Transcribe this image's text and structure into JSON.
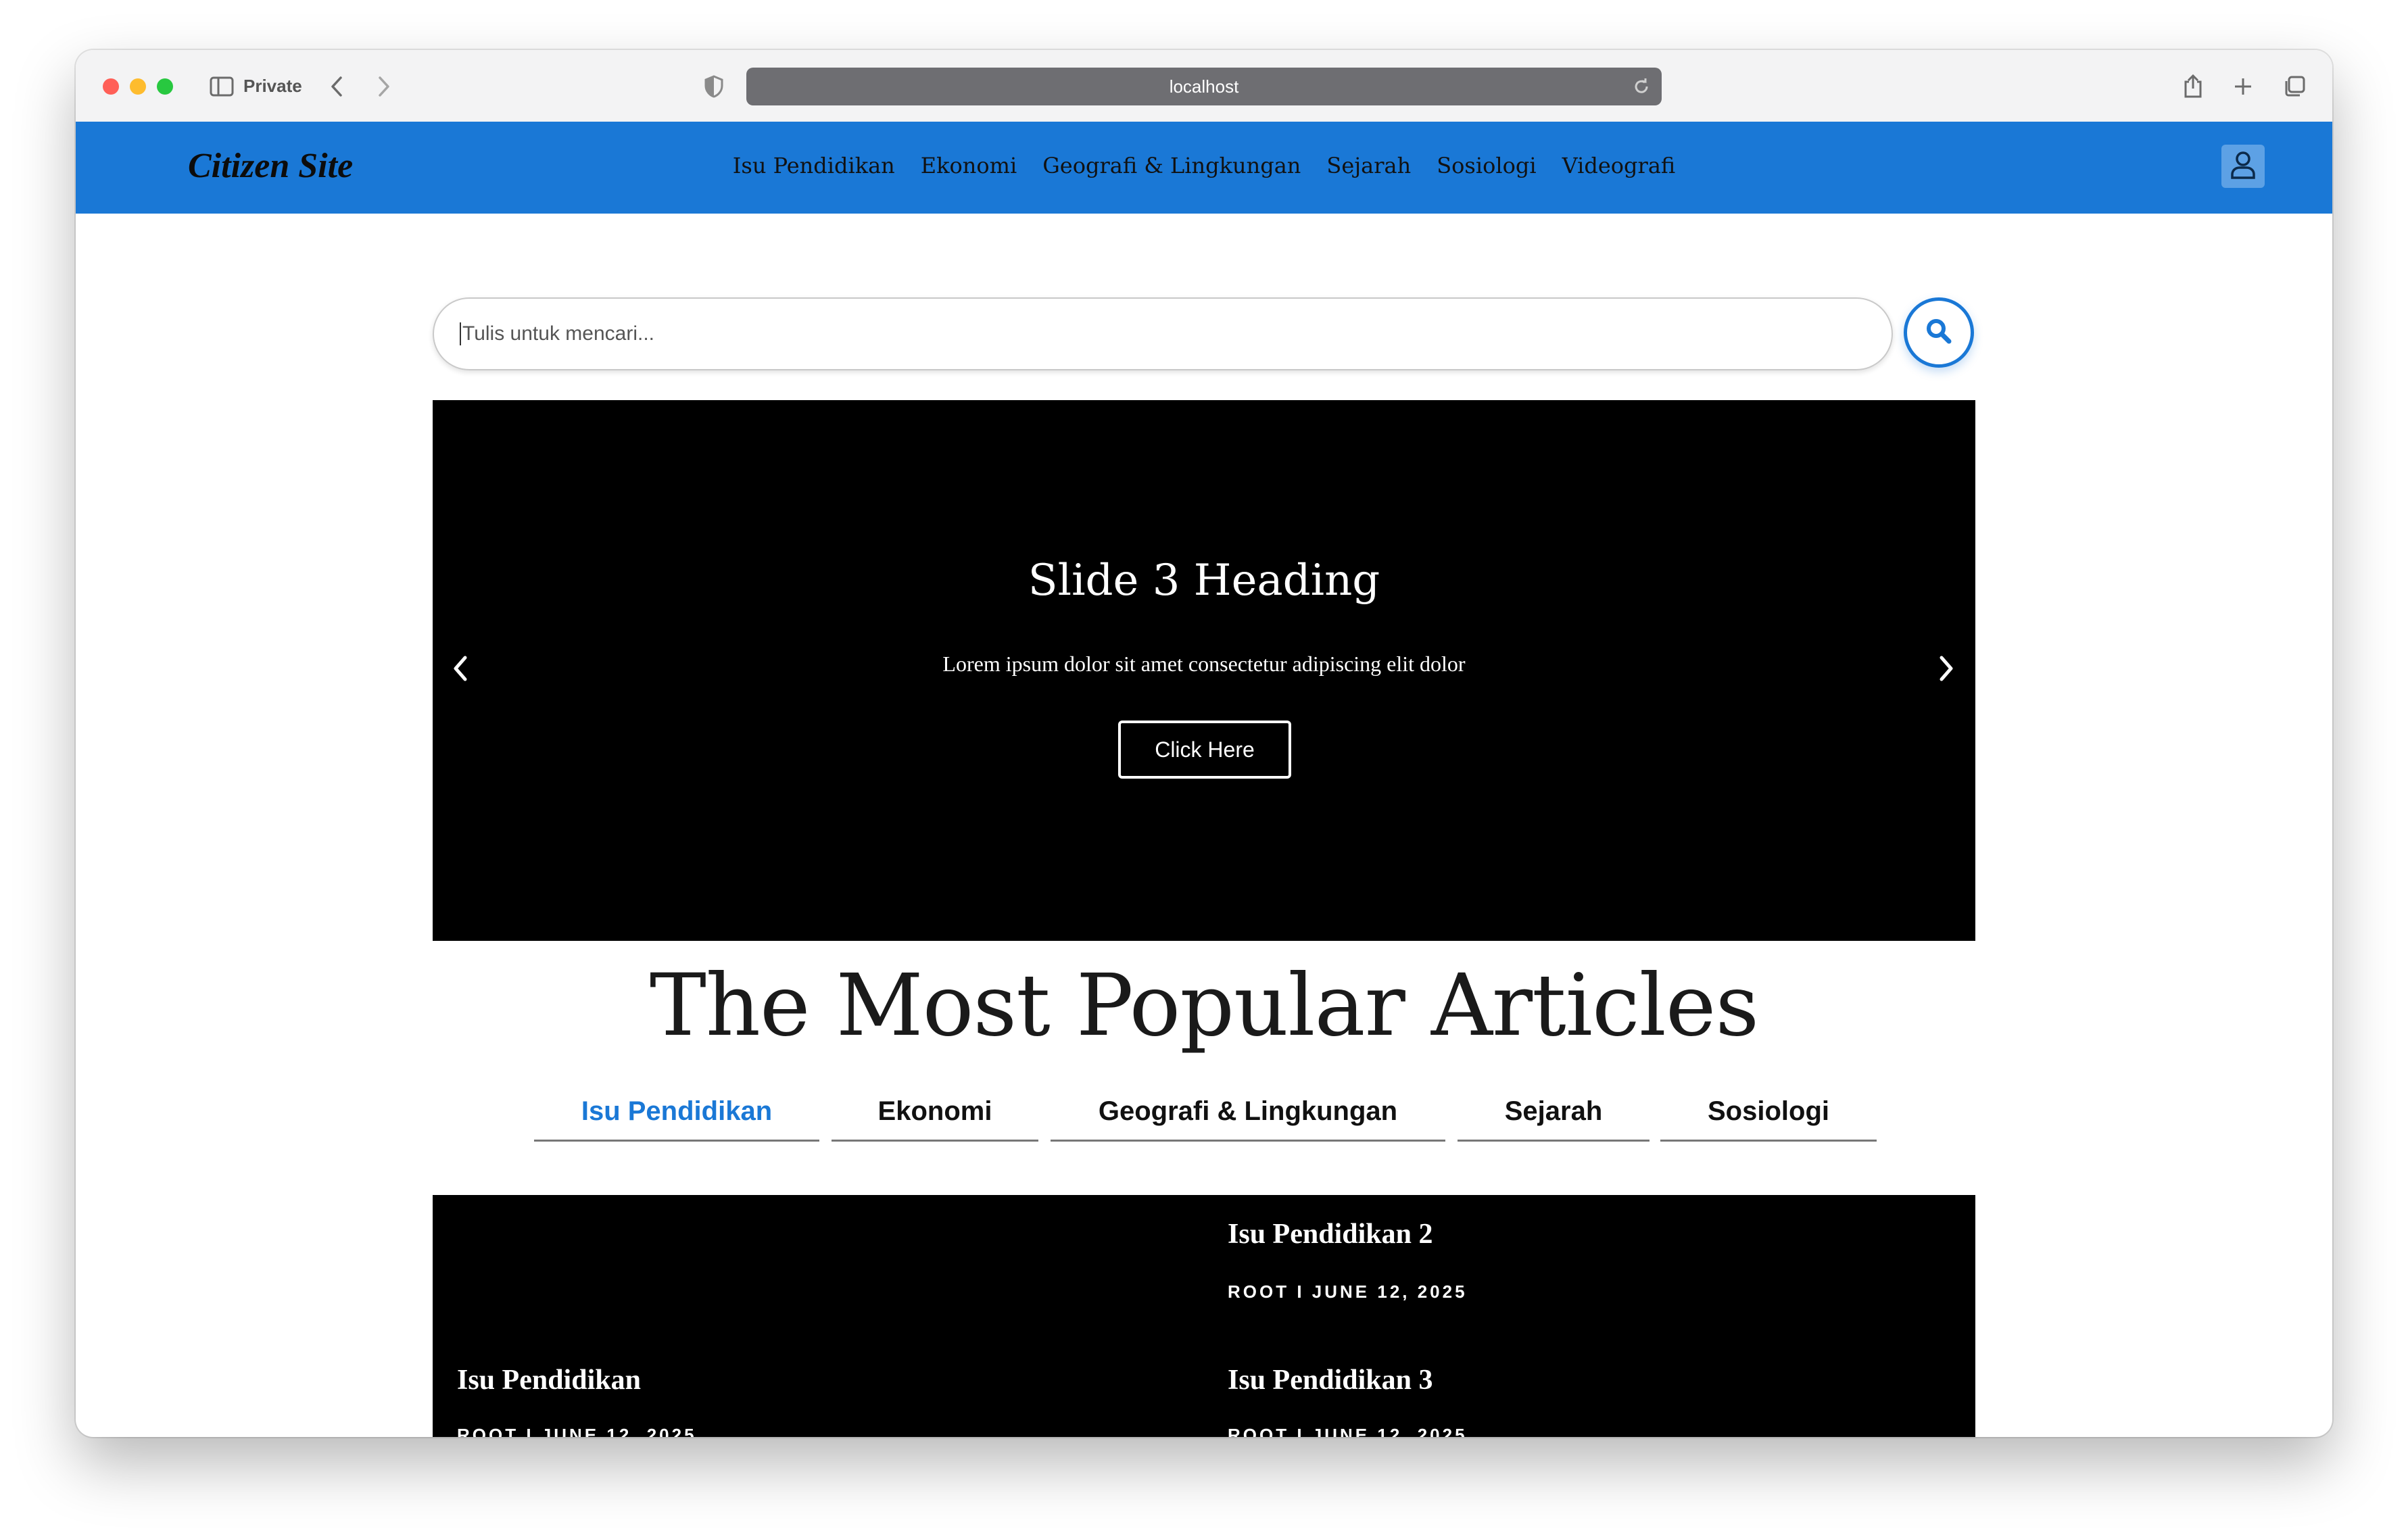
{
  "browser": {
    "private_label": "Private",
    "url": "localhost"
  },
  "site": {
    "brand": "Citizen Site",
    "nav": [
      "Isu Pendidikan",
      "Ekonomi",
      "Geografi & Lingkungan",
      "Sejarah",
      "Sosiologi",
      "Videografi"
    ]
  },
  "search": {
    "placeholder": "Tulis untuk mencari..."
  },
  "carousel": {
    "heading": "Slide 3 Heading",
    "text": "Lorem ipsum dolor sit amet consectetur adipiscing elit dolor",
    "button_label": "Click Here"
  },
  "section": {
    "title": "The Most Popular Articles"
  },
  "tabs": [
    "Isu Pendidikan",
    "Ekonomi",
    "Geografi & Lingkungan",
    "Sejarah",
    "Sosiologi"
  ],
  "active_tab": "Isu Pendidikan",
  "articles": [
    {
      "title": "Isu Pendidikan",
      "meta": "ROOT I JUNE 12, 2025"
    },
    {
      "title": "Isu Pendidikan 2",
      "meta": "ROOT I JUNE 12, 2025"
    },
    {
      "title": "Isu Pendidikan 3",
      "meta": "ROOT I JUNE 12, 2025"
    }
  ],
  "colors": {
    "brand_blue": "#1a78d6",
    "carousel_bg": "#000000"
  }
}
